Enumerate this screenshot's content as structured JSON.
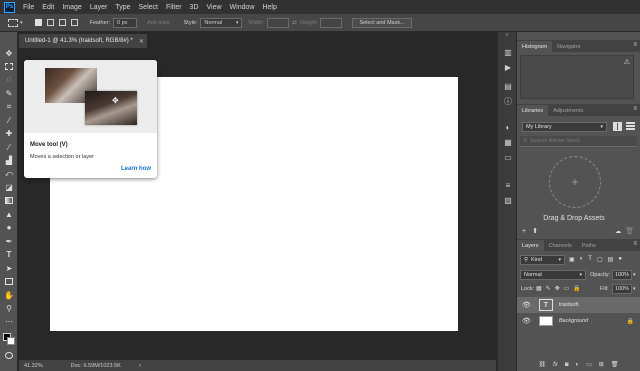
{
  "app": {
    "logo_text": "Ps"
  },
  "menu": [
    "File",
    "Edit",
    "Image",
    "Layer",
    "Type",
    "Select",
    "Filter",
    "3D",
    "View",
    "Window",
    "Help"
  ],
  "options": {
    "feather_label": "Feather:",
    "feather_value": "0 px",
    "antialias_label": "Anti-alias",
    "style_label": "Style:",
    "style_value": "Normal",
    "width_label": "Width:",
    "height_label": "Height:",
    "select_mask_label": "Select and Mask..."
  },
  "document": {
    "tab_title": "Untitled-1 @ 41.3% (traidsoft, RGB/8#) *",
    "zoom": "41.32%",
    "doc_info": "Doc: 6.59M/1023.5K"
  },
  "tooltip": {
    "title": "Move tool (V)",
    "description": "Moves a selection or layer",
    "link": "Learn how"
  },
  "histogram_panel": {
    "tabs": [
      "Histogram",
      "Navigator"
    ]
  },
  "libraries_panel": {
    "tabs": [
      "Libraries",
      "Adjustments"
    ],
    "library_name": "My Library",
    "search_placeholder": "Search Adobe Stock",
    "drop_text": "Drag & Drop Assets"
  },
  "layers_panel": {
    "tabs": [
      "Layers",
      "Channels",
      "Paths"
    ],
    "filter_kind": "Kind",
    "blend_mode": "Normal",
    "opacity_label": "Opacity:",
    "opacity_value": "100%",
    "lock_label": "Lock:",
    "fill_label": "Fill:",
    "fill_value": "100%",
    "layers": [
      {
        "name": "traidsoft",
        "type": "text"
      },
      {
        "name": "Background",
        "type": "image"
      }
    ]
  },
  "colors": {
    "accent": "#31a8ff",
    "link": "#1473e6"
  }
}
